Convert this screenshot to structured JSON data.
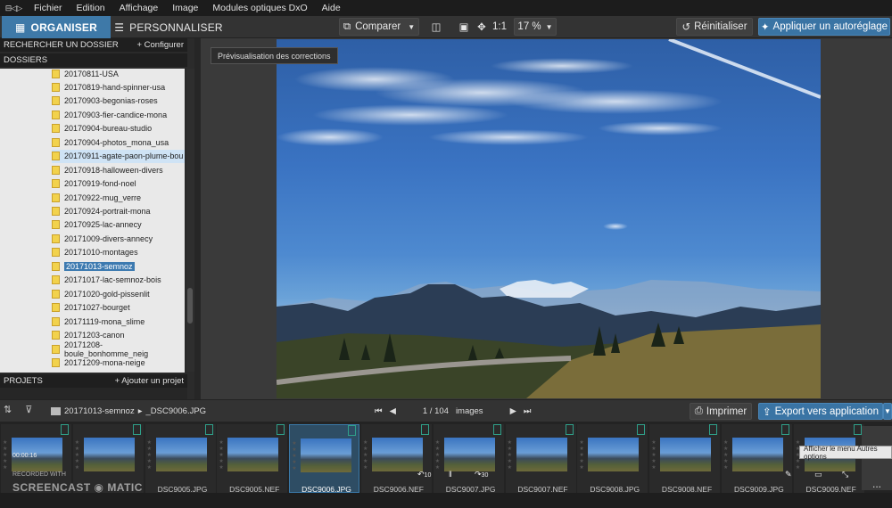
{
  "app": {
    "logo": "⊟◁▷"
  },
  "menu": [
    "Fichier",
    "Edition",
    "Affichage",
    "Image",
    "Modules optiques DxO",
    "Aide"
  ],
  "toolbar": {
    "tab_organize": "ORGANISER",
    "tab_personalize": "PERSONNALISER",
    "compare": "Comparer",
    "one_to_one": "1:1",
    "zoom": "17 %",
    "reset": "Réinitialiser",
    "auto_adjust": "Appliquer un autoréglage"
  },
  "left_panel": {
    "search_header": "RECHERCHER UN DOSSIER",
    "configure": "+ Configurer",
    "folders_header": "DOSSIERS",
    "folders": [
      "20170811-USA",
      "20170819-hand-spinner-usa",
      "20170903-begonias-roses",
      "20170903-fier-candice-mona",
      "20170904-bureau-studio",
      "20170904-photos_mona_usa",
      "20170911-agate-paon-plume-bou",
      "20170918-halloween-divers",
      "20170919-fond-noel",
      "20170922-mug_verre",
      "20170924-portrait-mona",
      "20170925-lac-annecy",
      "20171009-divers-annecy",
      "20171010-montages",
      "20171013-semnoz",
      "20171017-lac-semnoz-bois",
      "20171020-gold-pissenlit",
      "20171027-bourget",
      "20171119-mona_slime",
      "20171203-canon",
      "20171208-boule_bonhomme_neig",
      "20171209-mona-neige"
    ],
    "hovered_index": 6,
    "selected_index": 14,
    "projects_header": "PROJETS",
    "add_project": "+ Ajouter un projet"
  },
  "viewer": {
    "tooltip": "Prévisualisation des corrections"
  },
  "bottom_bar": {
    "path_folder": "20171013-semnoz",
    "path_sep": "▸",
    "path_file": "_DSC9006.JPG",
    "counter": "1 / 104",
    "counter_label": "images",
    "print": "Imprimer",
    "export": "Export vers application"
  },
  "filmstrip": {
    "items": [
      "",
      "",
      "_DSC9005.JPG",
      "_DSC9005.NEF",
      "_DSC9006.JPG",
      "_DSC9006.NEF",
      "_DSC9007.JPG",
      "_DSC9007.NEF",
      "_DSC9008.JPG",
      "_DSC9008.NEF",
      "_DSC9009.JPG",
      "_DSC9009.NEF"
    ],
    "selected_index": 4,
    "tooltip": "Afficher le menu Autres options",
    "rotate_left": "10",
    "rotate_right": "30",
    "more": "..."
  },
  "overlay": {
    "time": "00:00:16",
    "recorded_with": "RECORDED WITH",
    "brand": "SCREENCAST ◉ MATIC"
  },
  "colors": {
    "accent": "#3e79a8",
    "folder": "#f2d24c",
    "bg": "#2b2b2b"
  }
}
